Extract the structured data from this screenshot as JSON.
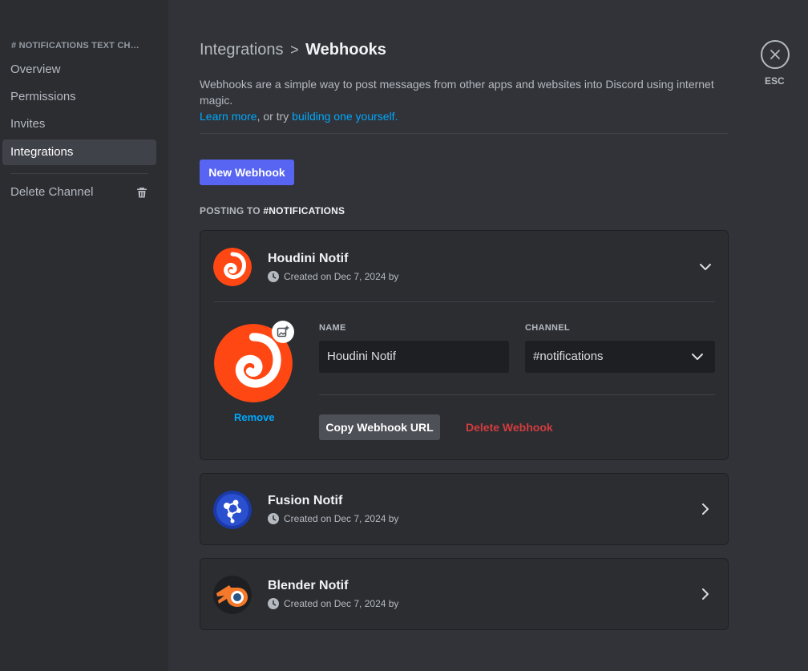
{
  "sidebar": {
    "header": "# NOTIFICATIONS TEXT CH…",
    "items": [
      {
        "label": "Overview"
      },
      {
        "label": "Permissions"
      },
      {
        "label": "Invites"
      },
      {
        "label": "Integrations"
      }
    ],
    "delete_label": "Delete Channel"
  },
  "header": {
    "crumb": "Integrations",
    "separator": ">",
    "current": "Webhooks",
    "description": "Webhooks are a simple way to post messages from other apps and websites into Discord using internet magic.",
    "learn_more": "Learn more",
    "or_try": ", or try",
    "build_link": "building one yourself."
  },
  "new_webhook_label": "New Webhook",
  "posting_to": {
    "prefix": "POSTING TO",
    "channel": "#NOTIFICATIONS"
  },
  "webhooks": [
    {
      "name": "Houdini Notif",
      "meta": "Created on Dec 7, 2024 by",
      "icon": "houdini-logo"
    },
    {
      "name": "Fusion Notif",
      "meta": "Created on Dec 7, 2024 by",
      "icon": "fusion-logo"
    },
    {
      "name": "Blender Notif",
      "meta": "Created on Dec 7, 2024 by",
      "icon": "blender-logo"
    }
  ],
  "editor": {
    "name_label": "NAME",
    "name_value": "Houdini Notif",
    "channel_label": "CHANNEL",
    "channel_value": "#notifications",
    "remove_label": "Remove",
    "copy_url_label": "Copy Webhook URL",
    "delete_label": "Delete Webhook"
  },
  "close": {
    "label": "ESC"
  },
  "colors": {
    "background": "#313338",
    "sidebar": "#2b2d31",
    "primary": "#5865f2",
    "link": "#00a8fc",
    "danger": "#f23f42",
    "houdini": "#ff4713"
  }
}
